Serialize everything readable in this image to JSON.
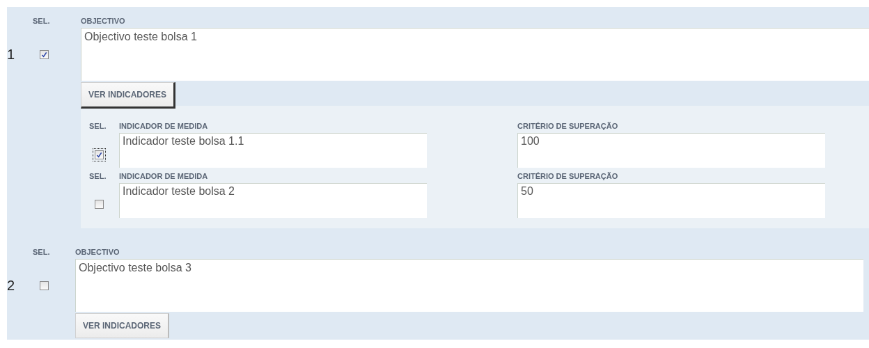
{
  "objectives": [
    {
      "number": "1",
      "sel_label": "SEL.",
      "label": "OBJECTIVO",
      "checked": true,
      "value": "Objectivo teste bolsa 1",
      "button": "VER INDICADORES",
      "pressed": true,
      "indicators": [
        {
          "sel_label": "SEL.",
          "label": "INDICADOR DE MEDIDA",
          "checked": true,
          "focused": true,
          "value": "Indicador teste bolsa 1.1",
          "criterion_label": "CRITÉRIO DE SUPERAÇÃO",
          "criterion": "100"
        },
        {
          "sel_label": "SEL.",
          "label": "INDICADOR DE MEDIDA",
          "checked": false,
          "focused": false,
          "value": "Indicador teste bolsa 2",
          "criterion_label": "CRITÉRIO DE SUPERAÇÃO",
          "criterion": "50"
        }
      ]
    },
    {
      "number": "2",
      "sel_label": "SEL.",
      "label": "OBJECTIVO",
      "checked": false,
      "value": "Objectivo teste bolsa 3",
      "button": "VER INDICADORES",
      "pressed": false
    }
  ]
}
